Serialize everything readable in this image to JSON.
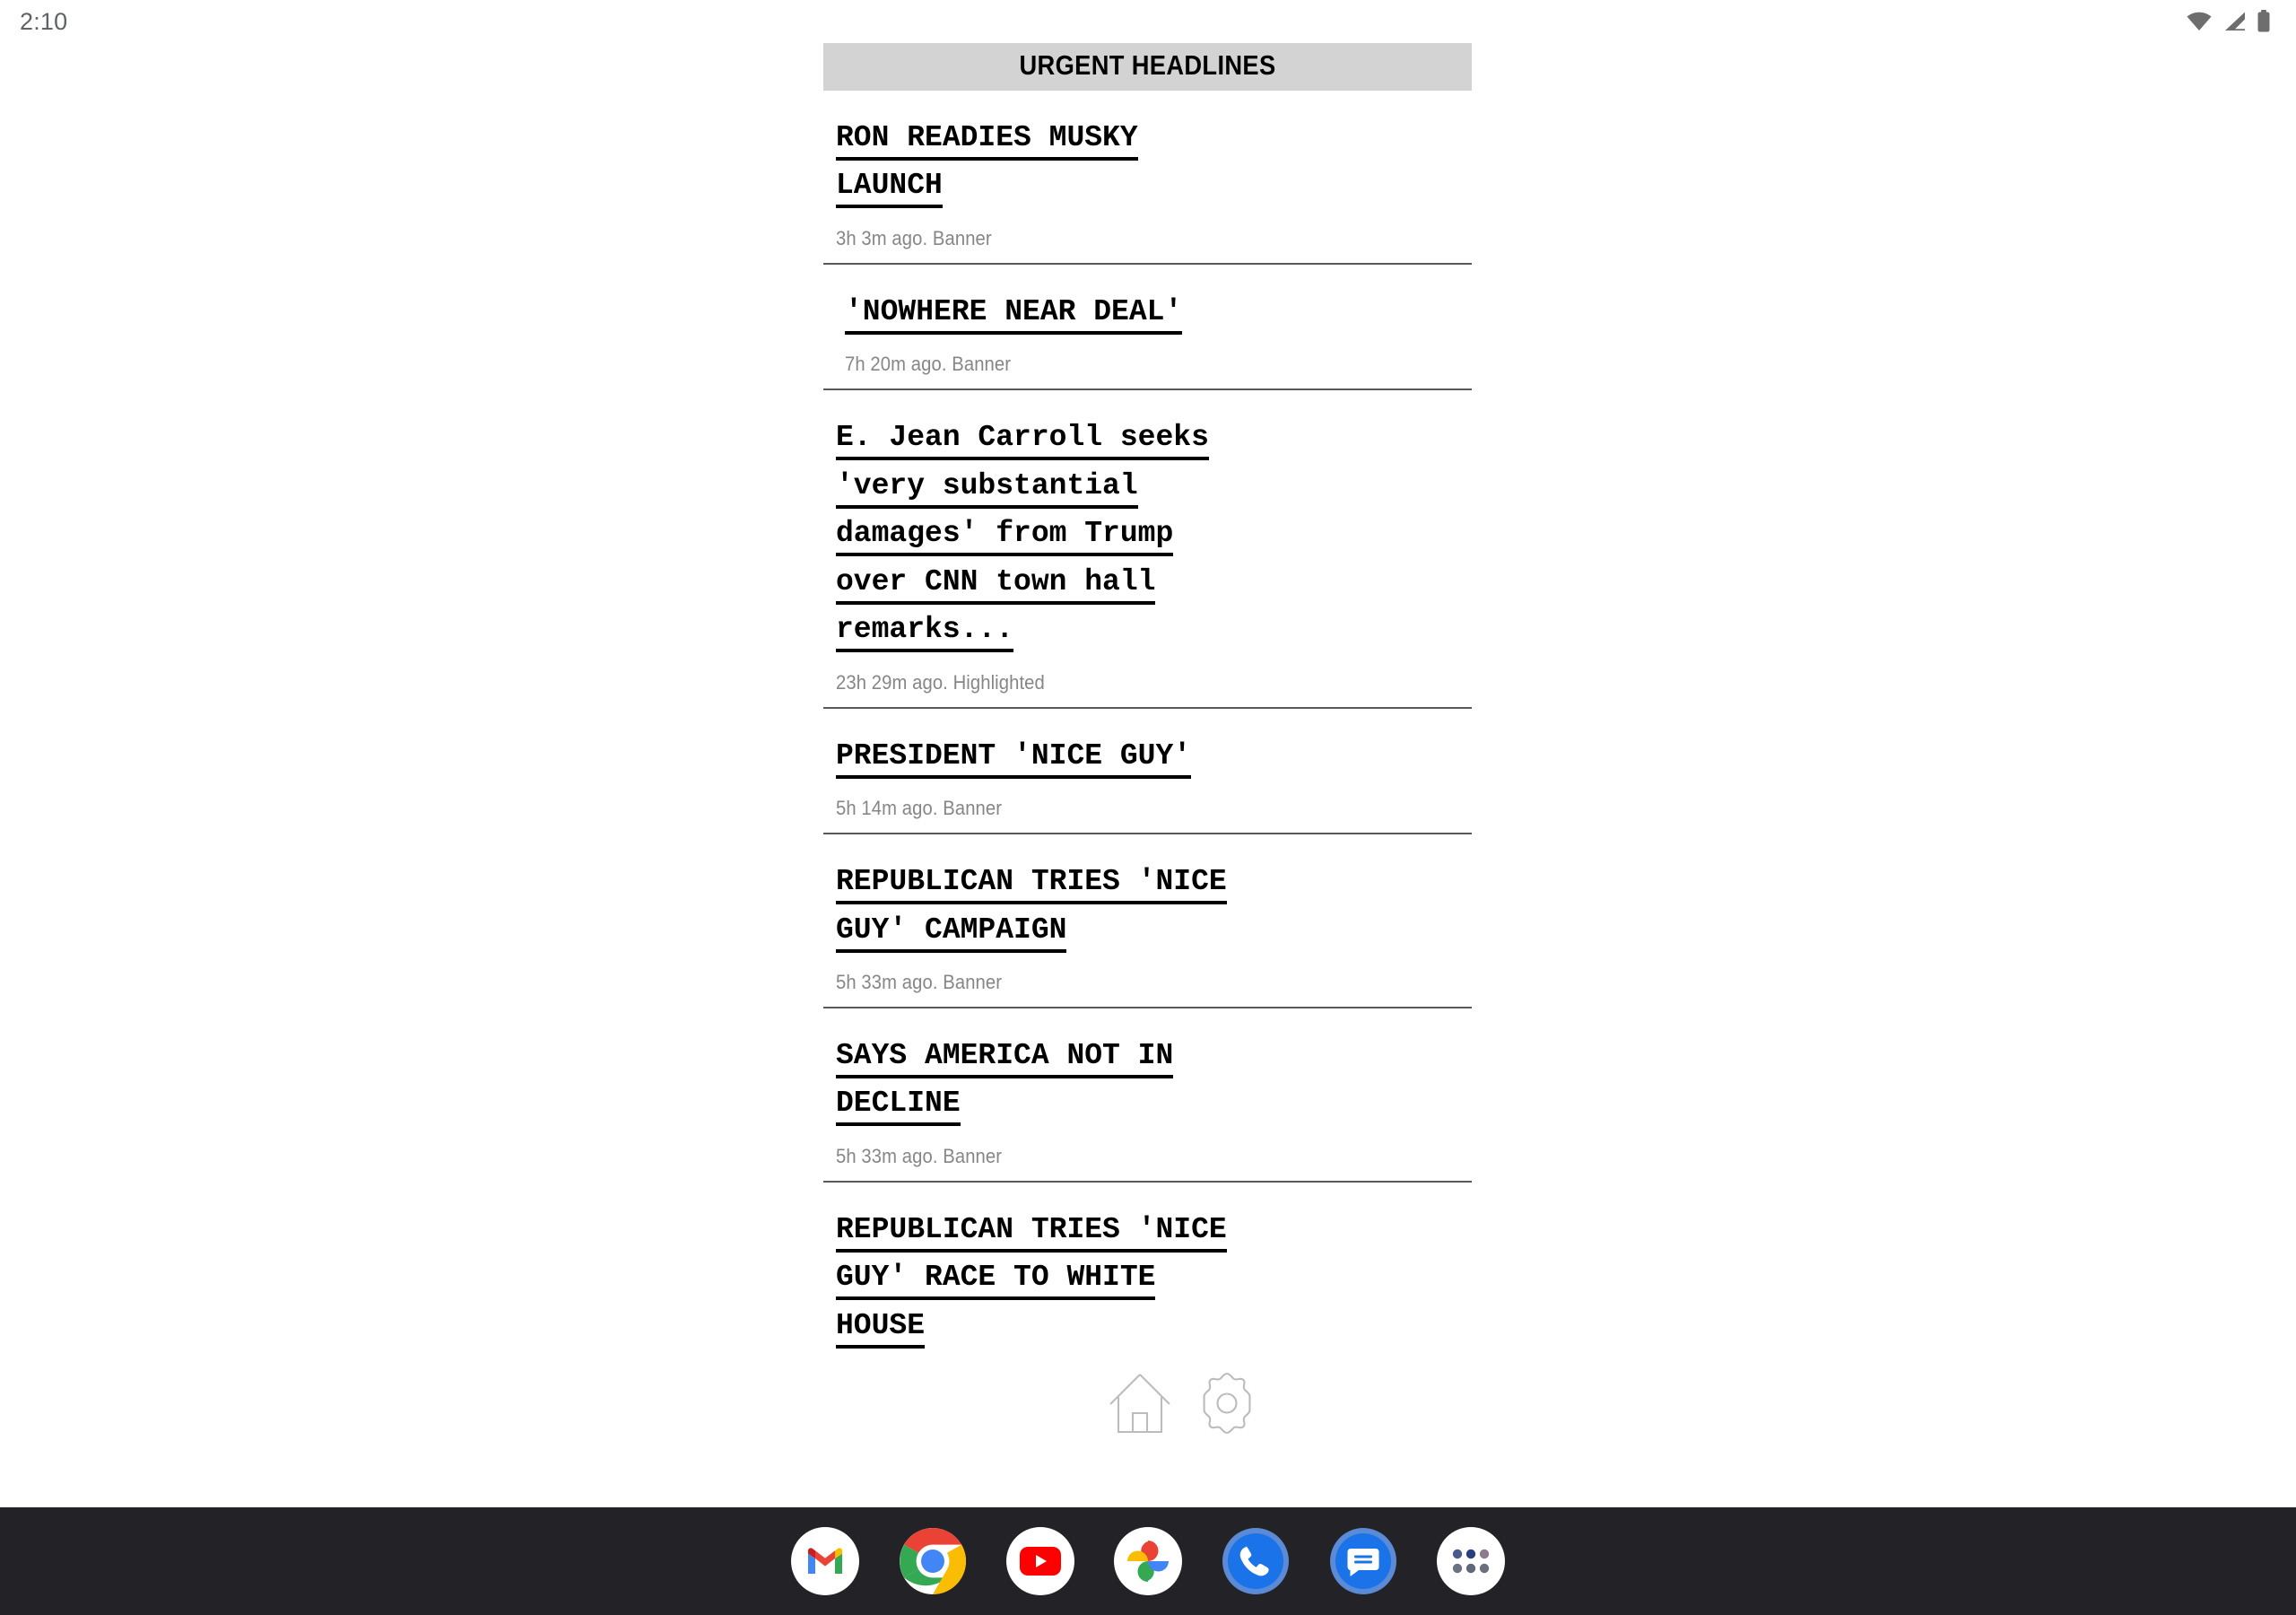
{
  "status_bar": {
    "clock": "2:10",
    "icons": [
      {
        "name": "wifi-icon",
        "label": "wifi"
      },
      {
        "name": "cellular-signal-icon",
        "label": "cellular signal"
      },
      {
        "name": "battery-icon",
        "label": "battery"
      }
    ],
    "icon_color": "#6e6e6e"
  },
  "page": {
    "header_title": "URGENT HEADLINES",
    "header_bg": "#d3d3d3",
    "background": "#ffffff"
  },
  "headlines": [
    {
      "lines": [
        "RON READIES MUSKY",
        "LAUNCH"
      ],
      "meta": "3h 3m ago. Banner",
      "indent": false
    },
    {
      "lines": [
        "'NOWHERE NEAR DEAL'"
      ],
      "meta": "7h 20m ago. Banner",
      "indent": true
    },
    {
      "lines": [
        "E. Jean Carroll seeks",
        "'very substantial",
        "damages' from Trump",
        "over CNN town hall",
        "remarks..."
      ],
      "meta": "23h 29m ago. Highlighted",
      "indent": false
    },
    {
      "lines": [
        "PRESIDENT 'NICE GUY'"
      ],
      "meta": "5h 14m ago. Banner",
      "indent": false
    },
    {
      "lines": [
        "REPUBLICAN TRIES 'NICE",
        "GUY' CAMPAIGN"
      ],
      "meta": "5h 33m ago. Banner",
      "indent": false
    },
    {
      "lines": [
        "SAYS AMERICA NOT IN",
        "DECLINE"
      ],
      "meta": "5h 33m ago. Banner",
      "indent": false
    },
    {
      "lines": [
        "REPUBLICAN TRIES 'NICE",
        "GUY' RACE TO WHITE",
        "HOUSE"
      ],
      "meta": "",
      "indent": false
    }
  ],
  "floating_widget": {
    "icons": [
      {
        "name": "house-outline-icon",
        "label": "home"
      },
      {
        "name": "gear-icon",
        "label": "settings"
      }
    ]
  },
  "dock": {
    "background": "#232327",
    "apps": [
      {
        "name": "gmail-icon",
        "label": "Gmail"
      },
      {
        "name": "chrome-icon",
        "label": "Chrome"
      },
      {
        "name": "youtube-icon",
        "label": "YouTube"
      },
      {
        "name": "google-photos-icon",
        "label": "Photos"
      },
      {
        "name": "phone-icon",
        "label": "Phone"
      },
      {
        "name": "messages-icon",
        "label": "Messages"
      },
      {
        "name": "app-drawer-icon",
        "label": "All apps"
      }
    ]
  }
}
